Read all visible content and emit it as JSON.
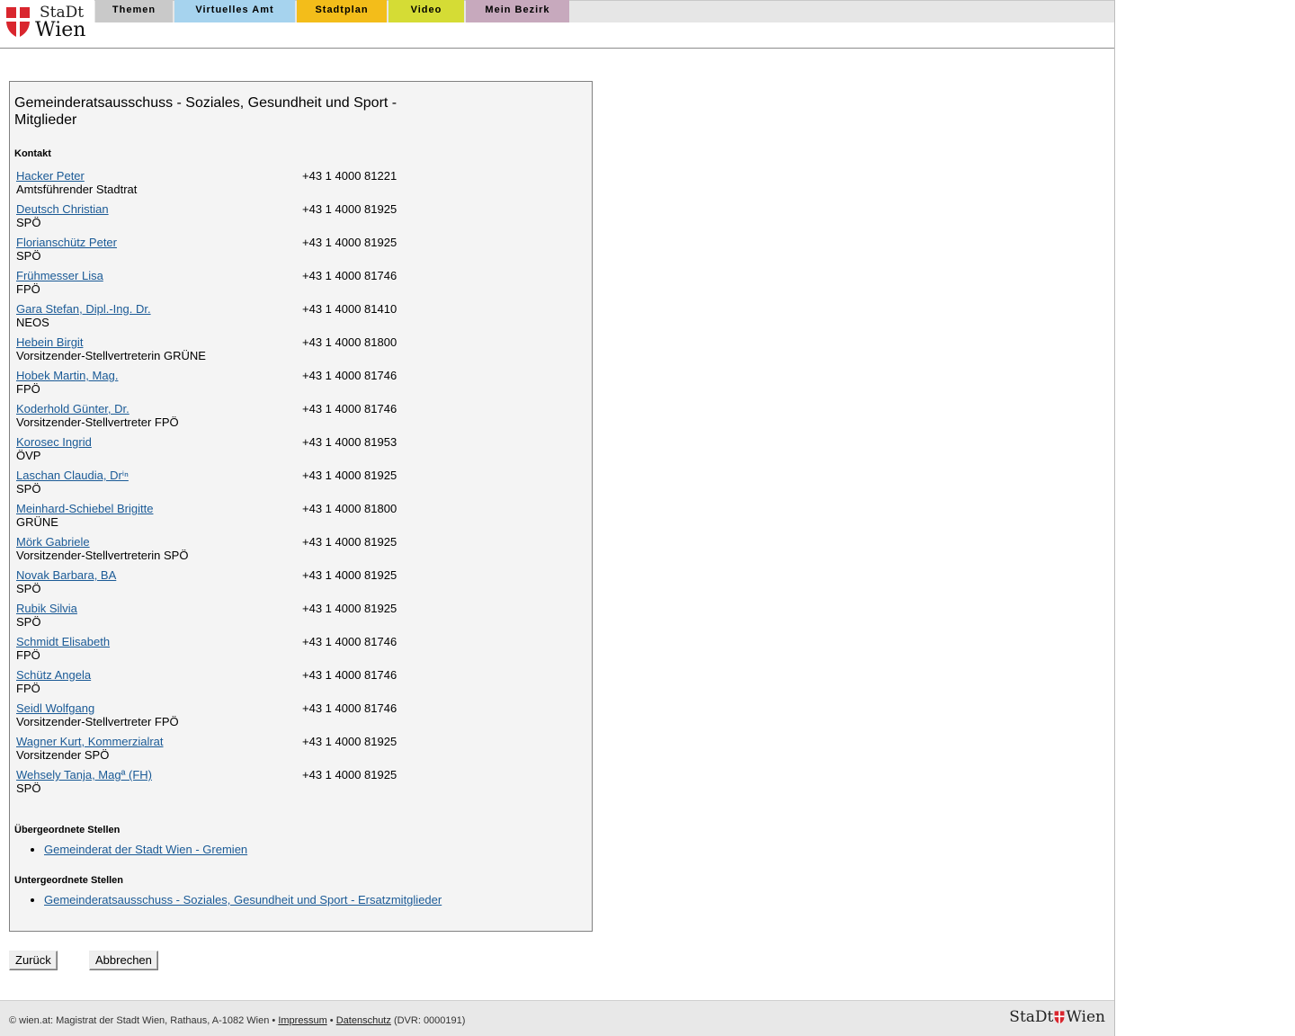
{
  "logo": {
    "line1": "StaDt",
    "line2": "Wien"
  },
  "nav": [
    {
      "label": "Themen",
      "color": "#c9c9c9"
    },
    {
      "label": "Virtuelles Amt",
      "color": "#a6d3ee"
    },
    {
      "label": "Stadtplan",
      "color": "#f3bd1a"
    },
    {
      "label": "Video",
      "color": "#d5dc35"
    },
    {
      "label": "Mein Bezirk",
      "color": "#c7a9bd"
    }
  ],
  "panel": {
    "title": "Gemeinderatsausschuss - Soziales, Gesundheit und Sport - Mitglieder",
    "kontakt_heading": "Kontakt",
    "members": [
      {
        "name": "Hacker Peter",
        "role": "Amtsführender Stadtrat",
        "phone": "+43 1 4000 81221"
      },
      {
        "name": "Deutsch Christian",
        "role": "SPÖ",
        "phone": "+43 1 4000 81925"
      },
      {
        "name": "Florianschütz Peter",
        "role": "SPÖ",
        "phone": "+43 1 4000 81925"
      },
      {
        "name": "Frühmesser Lisa",
        "role": "FPÖ",
        "phone": "+43 1 4000 81746"
      },
      {
        "name": "Gara Stefan, Dipl.-Ing. Dr.",
        "role": "NEOS",
        "phone": "+43 1 4000 81410"
      },
      {
        "name": "Hebein Birgit",
        "role": "Vorsitzender-Stellvertreterin GRÜNE",
        "phone": "+43 1 4000 81800"
      },
      {
        "name": "Hobek Martin, Mag.",
        "role": "FPÖ",
        "phone": "+43 1 4000 81746"
      },
      {
        "name": "Koderhold Günter, Dr.",
        "role": "Vorsitzender-Stellvertreter FPÖ",
        "phone": "+43 1 4000 81746"
      },
      {
        "name": "Korosec Ingrid",
        "role": "ÖVP",
        "phone": "+43 1 4000 81953"
      },
      {
        "name": "Laschan Claudia, Drⁱⁿ",
        "role": "SPÖ",
        "phone": "+43 1 4000 81925"
      },
      {
        "name": "Meinhard-Schiebel Brigitte",
        "role": "GRÜNE",
        "phone": "+43 1 4000 81800"
      },
      {
        "name": "Mörk Gabriele",
        "role": "Vorsitzender-Stellvertreterin SPÖ",
        "phone": "+43 1 4000 81925"
      },
      {
        "name": "Novak Barbara, BA",
        "role": "SPÖ",
        "phone": "+43 1 4000 81925"
      },
      {
        "name": "Rubik Silvia",
        "role": "SPÖ",
        "phone": "+43 1 4000 81925"
      },
      {
        "name": "Schmidt Elisabeth",
        "role": "FPÖ",
        "phone": "+43 1 4000 81746"
      },
      {
        "name": "Schütz Angela",
        "role": "FPÖ",
        "phone": "+43 1 4000 81746"
      },
      {
        "name": "Seidl Wolfgang",
        "role": "Vorsitzender-Stellvertreter FPÖ",
        "phone": "+43 1 4000 81746"
      },
      {
        "name": "Wagner Kurt, Kommerzialrat",
        "role": "Vorsitzender SPÖ",
        "phone": "+43 1 4000 81925"
      },
      {
        "name": "Wehsely Tanja, Magª (FH)",
        "role": "SPÖ",
        "phone": "+43 1 4000 81925"
      }
    ],
    "parent_heading": "Übergeordnete Stellen",
    "parent_links": [
      "Gemeinderat der Stadt Wien - Gremien"
    ],
    "child_heading": "Untergeordnete Stellen",
    "child_links": [
      "Gemeinderatsausschuss - Soziales, Gesundheit und Sport - Ersatzmitglieder"
    ]
  },
  "buttons": {
    "back": "Zurück",
    "cancel": "Abbrechen"
  },
  "footer": {
    "copyright": "© wien.at: Magistrat der Stadt Wien, Rathaus, A-1082 Wien •",
    "impressum": "Impressum",
    "separator": "•",
    "datenschutz": "Datenschutz",
    "dvr": "(DVR: 0000191)",
    "logo_left": "StaDt",
    "logo_right": "Wien"
  }
}
